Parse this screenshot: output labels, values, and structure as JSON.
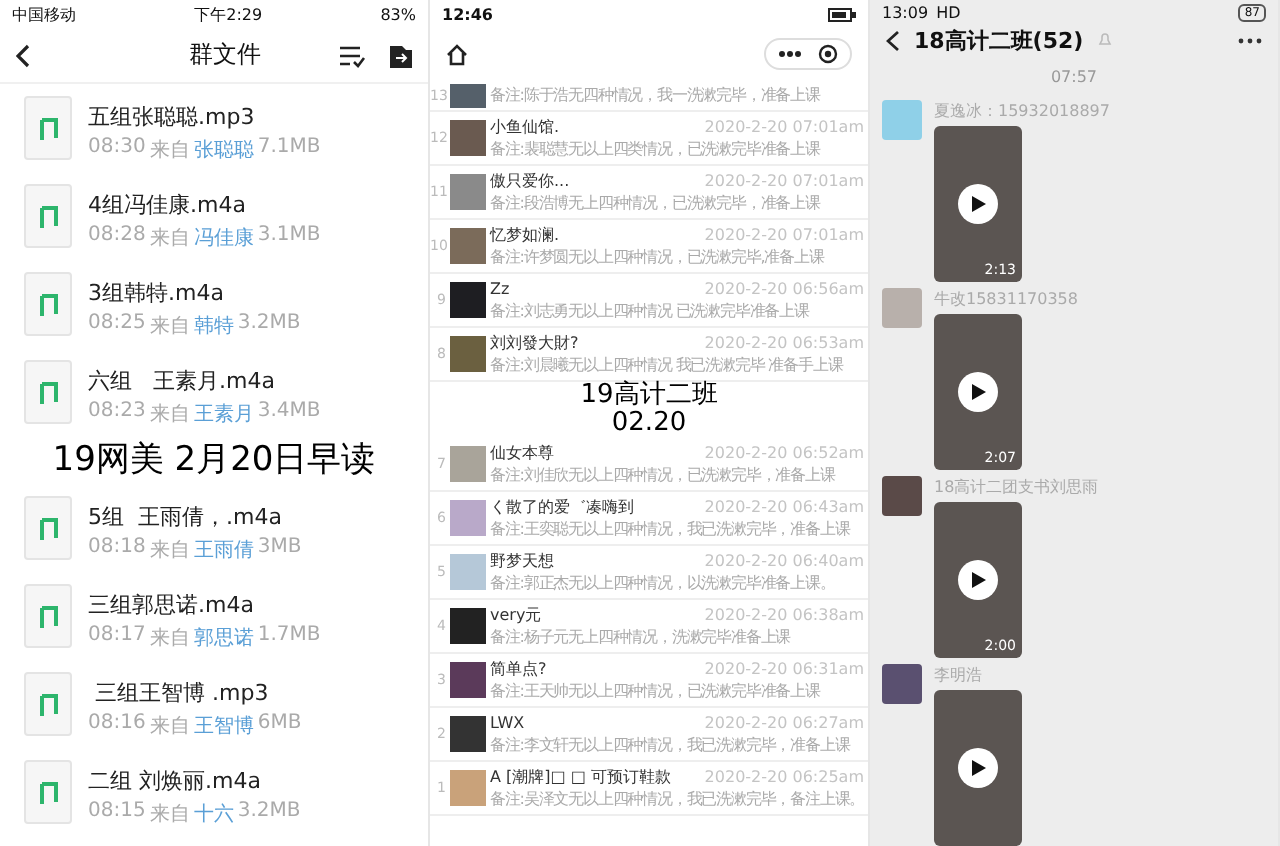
{
  "file_panel": {
    "status_bar": {
      "carrier": "中国移动",
      "time": "下午2:29",
      "battery": "83%"
    },
    "title": "群文件",
    "caption": "19网美 2月20日早读",
    "files": [
      {
        "name": "五组张聪聪.mp3",
        "time": "08:30",
        "from_label": "来自",
        "sender": "张聪聪",
        "size": "7.1MB"
      },
      {
        "name": "4组冯佳康.m4a",
        "time": "08:28",
        "from_label": "来自",
        "sender": "冯佳康",
        "size": "3.1MB"
      },
      {
        "name": "3组韩特.m4a",
        "time": "08:25",
        "from_label": "来自",
        "sender": "韩特",
        "size": "3.2MB"
      },
      {
        "name": "六组   王素月.m4a",
        "time": "08:23",
        "from_label": "来自",
        "sender": "王素月",
        "size": "3.4MB"
      },
      {
        "name": "5组  王雨倩，.m4a",
        "time": "08:18",
        "from_label": "来自",
        "sender": "王雨倩",
        "size": "3MB"
      },
      {
        "name": "三组郭思诺.m4a",
        "time": "08:17",
        "from_label": "来自",
        "sender": "郭思诺",
        "size": "1.7MB"
      },
      {
        "name": " 三组王智博 .mp3",
        "time": "08:16",
        "from_label": "来自",
        "sender": "王智博",
        "size": "6MB"
      },
      {
        "name": "二组 刘焕丽.m4a",
        "time": "08:15",
        "from_label": "来自",
        "sender": "十六",
        "size": "3.2MB"
      }
    ]
  },
  "checkin_panel": {
    "status_bar": {
      "time": "12:46"
    },
    "caption": "19高计二班",
    "caption_date": "02.20",
    "partial_entry": {
      "index": "13",
      "note": "备注:陈于浩无四种情况，我一洗漱完毕，准备上课"
    },
    "entries": [
      {
        "index": "12",
        "name": "小鱼仙馆.",
        "time": "2020-2-20 07:01am",
        "note": "备注:裴聪慧无以上四类情况，已洗漱完毕准备上课"
      },
      {
        "index": "11",
        "name": "傲只爱你...",
        "time": "2020-2-20 07:01am",
        "note": "备注:段浩博无上四种情况，已洗漱完毕，准备上课"
      },
      {
        "index": "10",
        "name": "忆梦如澜.",
        "time": "2020-2-20 07:01am",
        "note": "备注:许梦圆无以上四种情况，已洗漱完毕,准备上课"
      },
      {
        "index": "9",
        "name": "Zz",
        "time": "2020-2-20 06:56am",
        "note": "备注:刘志勇无以上四种情况 已洗漱完毕准备上课"
      },
      {
        "index": "8",
        "name": "刘刘發大財?",
        "time": "2020-2-20 06:53am",
        "note": "备注:刘晨曦无以上四种情况 我已洗漱完毕 准备手上课"
      },
      {
        "index": "7",
        "name": "仙女本尊",
        "time": "2020-2-20 06:52am",
        "note": "备注:刘佳欣无以上四种情况，已洗漱完毕，准备上课"
      },
      {
        "index": "6",
        "name": "く散了的爱゛凑嗨到",
        "time": "2020-2-20 06:43am",
        "note": "备注:王奕聪无以上四种情况，我已洗漱完毕，准备上课"
      },
      {
        "index": "5",
        "name": "野梦天想",
        "time": "2020-2-20 06:40am",
        "note": "备注:郭正杰无以上四种情况，以洗漱完毕准备上课。"
      },
      {
        "index": "4",
        "name": "very元",
        "time": "2020-2-20 06:38am",
        "note": "备注:杨子元无上四种情况，洗漱完毕准备上课"
      },
      {
        "index": "3",
        "name": "简单点?",
        "time": "2020-2-20 06:31am",
        "note": "备注:王天帅无以上四种情况，已洗漱完毕准备上课"
      },
      {
        "index": "2",
        "name": "LWX",
        "time": "2020-2-20 06:27am",
        "note": "备注:李文轩无以上四种情况，我已洗漱完毕，准备上课"
      },
      {
        "index": "1",
        "name": "A [潮牌]□ □ 可预订鞋款",
        "time": "2020-2-20 06:25am",
        "note": "备注:吴泽文无以上四种情况，我已洗漱完毕，备注上课。"
      }
    ]
  },
  "chat_panel": {
    "status_bar": {
      "time": "13:09",
      "network": "HD",
      "battery": "87"
    },
    "title": "18高计二班(52)",
    "timestamp": "07:57",
    "messages": [
      {
        "sender": "夏逸冰：15932018897",
        "duration": "2:13"
      },
      {
        "sender": "牛改15831170358",
        "duration": "2:07"
      },
      {
        "sender": "18高计二团支书刘思雨",
        "duration": "2:00"
      },
      {
        "sender": "李明浩"
      }
    ]
  }
}
